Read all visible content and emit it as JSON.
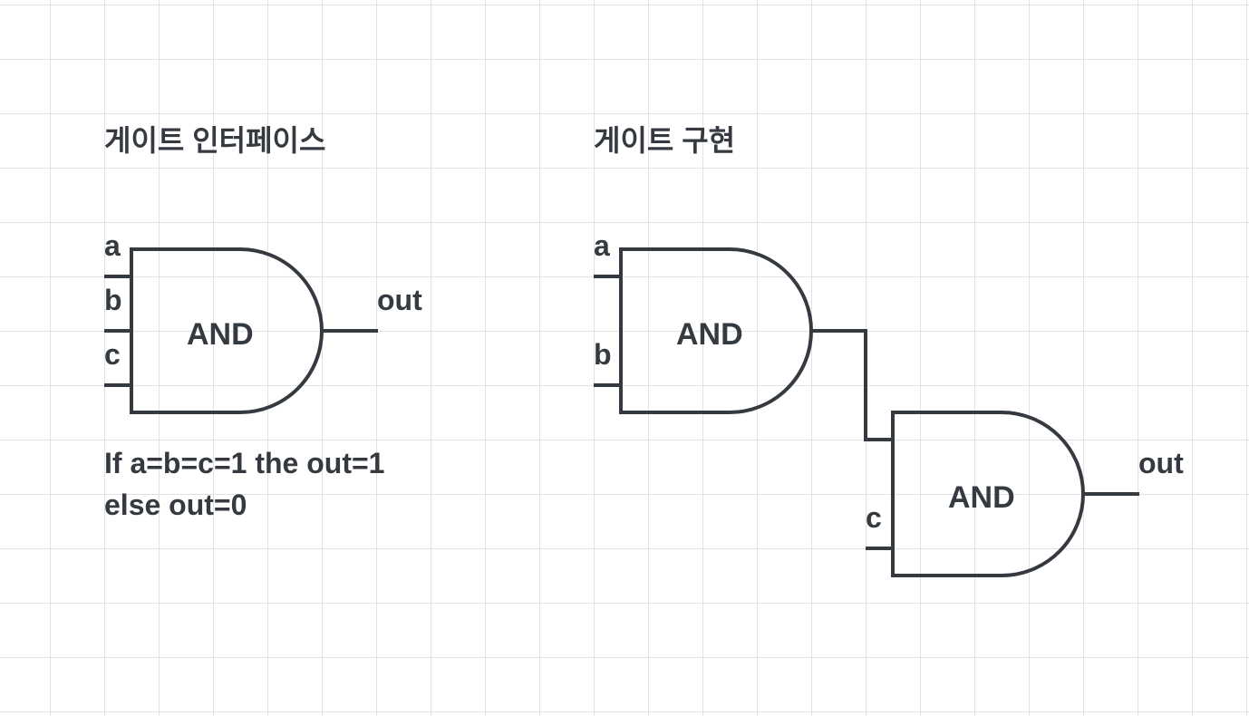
{
  "left_panel": {
    "title": "게이트 인터페이스",
    "gate": {
      "label": "AND",
      "inputs": [
        "a",
        "b",
        "c"
      ],
      "output": "out"
    },
    "description": [
      "If a=b=c=1 the out=1",
      "else out=0"
    ]
  },
  "right_panel": {
    "title": "게이트 구현",
    "gate1": {
      "label": "AND",
      "inputs": [
        "a",
        "b"
      ]
    },
    "gate2": {
      "label": "AND",
      "inputs": [
        "c"
      ],
      "output": "out"
    }
  },
  "colors": {
    "stroke": "#343a40",
    "grid": "#e2e2e2",
    "background": "#ffffff"
  }
}
